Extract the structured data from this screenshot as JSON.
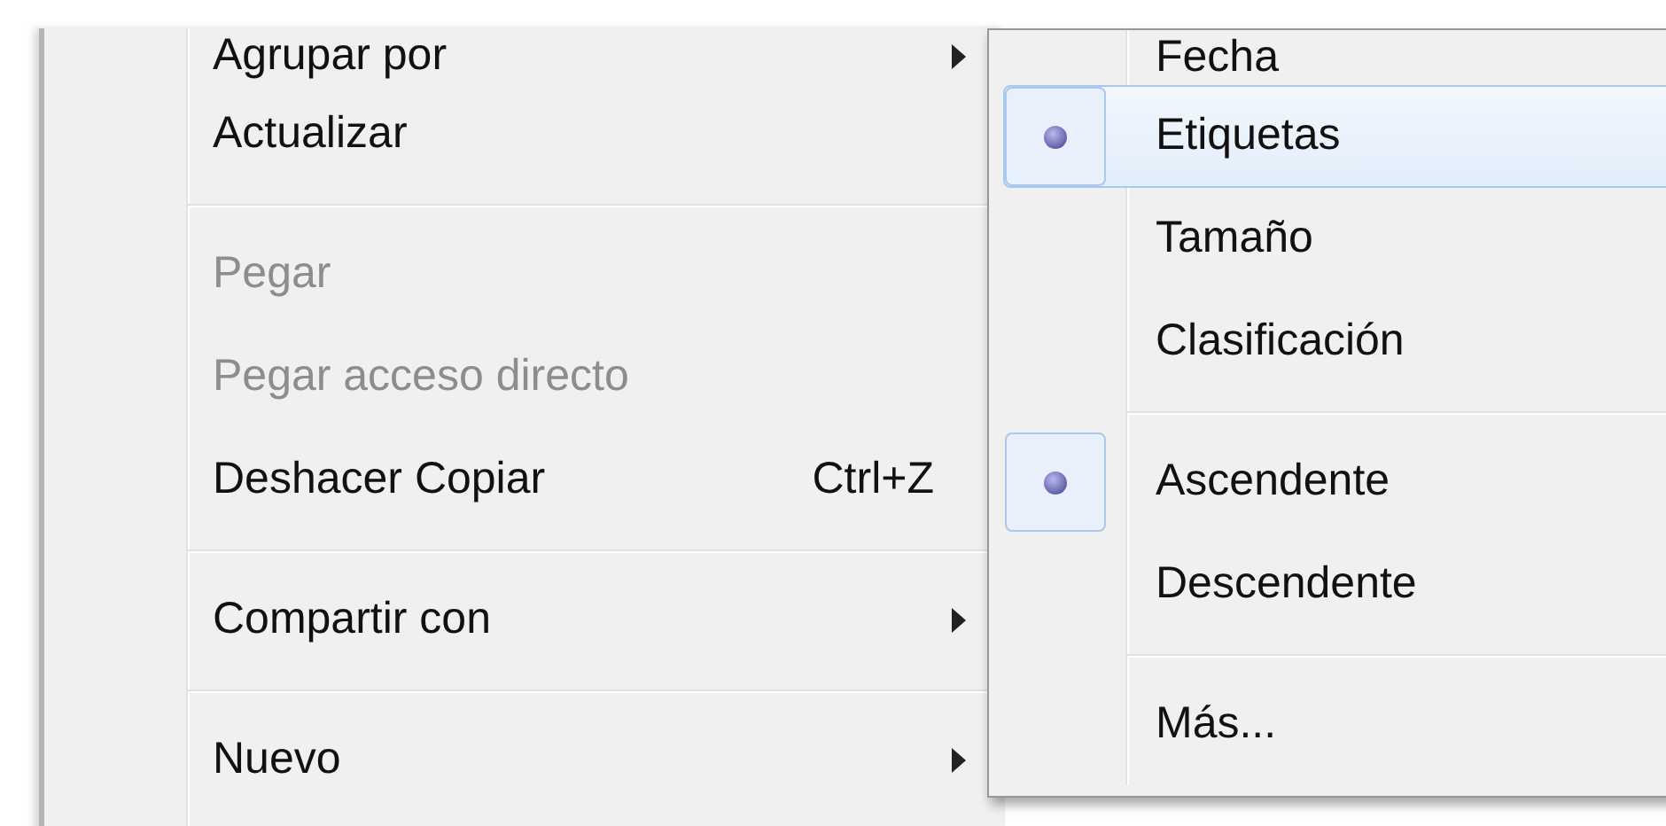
{
  "menu": {
    "items": [
      {
        "kind": "item",
        "label": "Agrupar por",
        "disabled": false,
        "has_submenu": true
      },
      {
        "kind": "item",
        "label": "Actualizar",
        "disabled": false,
        "has_submenu": false
      },
      {
        "kind": "separator"
      },
      {
        "kind": "item",
        "label": "Pegar",
        "disabled": true,
        "has_submenu": false
      },
      {
        "kind": "item",
        "label": "Pegar acceso directo",
        "disabled": true,
        "has_submenu": false
      },
      {
        "kind": "item",
        "label": "Deshacer Copiar",
        "shortcut": "Ctrl+Z",
        "disabled": false,
        "has_submenu": false
      },
      {
        "kind": "separator"
      },
      {
        "kind": "item",
        "label": "Compartir con",
        "disabled": false,
        "has_submenu": true
      },
      {
        "kind": "separator"
      },
      {
        "kind": "item",
        "label": "Nuevo",
        "disabled": false,
        "has_submenu": true
      }
    ]
  },
  "submenu": {
    "items": [
      {
        "kind": "item",
        "label": "Fecha",
        "selected": false,
        "highlighted": false
      },
      {
        "kind": "item",
        "label": "Etiquetas",
        "selected": true,
        "highlighted": true
      },
      {
        "kind": "item",
        "label": "Tamaño",
        "selected": false,
        "highlighted": false
      },
      {
        "kind": "item",
        "label": "Clasificación",
        "selected": false,
        "highlighted": false
      },
      {
        "kind": "separator"
      },
      {
        "kind": "item",
        "label": "Ascendente",
        "selected": true,
        "highlighted": false
      },
      {
        "kind": "item",
        "label": "Descendente",
        "selected": false,
        "highlighted": false
      },
      {
        "kind": "separator"
      },
      {
        "kind": "item",
        "label": "Más...",
        "selected": false,
        "highlighted": false
      }
    ]
  }
}
